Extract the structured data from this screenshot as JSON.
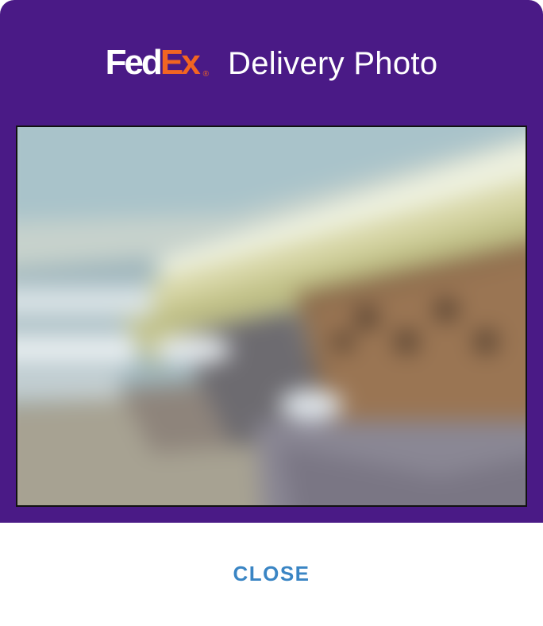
{
  "dialog": {
    "logo": {
      "fed": "Fed",
      "ex": "Ex",
      "reg": "®"
    },
    "title": "Delivery Photo",
    "photo_icon": "delivery-photo-image",
    "close_label": "CLOSE"
  },
  "colors": {
    "header_bg": "#4a1a86",
    "fedex_purple": "#ffffff",
    "fedex_orange": "#f26522",
    "close_text": "#3a85c4"
  }
}
